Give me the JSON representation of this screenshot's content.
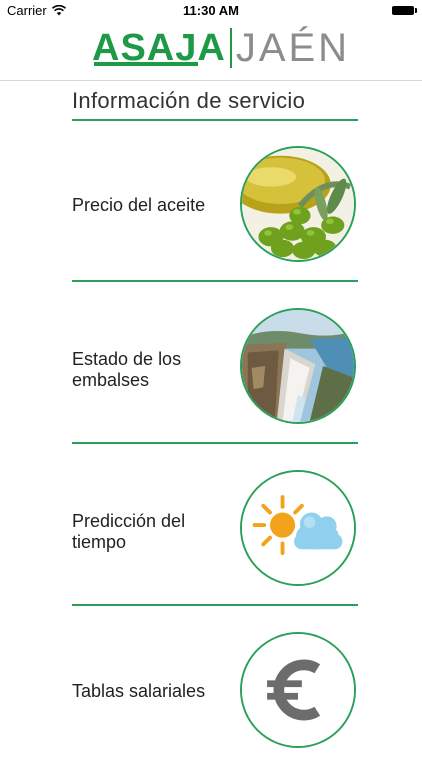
{
  "status_bar": {
    "carrier": "Carrier",
    "time": "11:30 AM"
  },
  "header": {
    "logo_primary": "ASAJA",
    "logo_secondary": "JAÉN"
  },
  "section_title": "Información de servicio",
  "items": [
    {
      "label": "Precio del aceite",
      "icon": "olive-oil-image"
    },
    {
      "label": "Estado de los embalses",
      "icon": "reservoir-dam-image"
    },
    {
      "label": "Predicción del tiempo",
      "icon": "weather-sun-cloud-icon"
    },
    {
      "label": "Tablas salariales",
      "icon": "euro-icon"
    }
  ],
  "colors": {
    "accent": "#2aa05a",
    "brand_green": "#1e9a47",
    "brand_gray": "#8c8c8c"
  }
}
